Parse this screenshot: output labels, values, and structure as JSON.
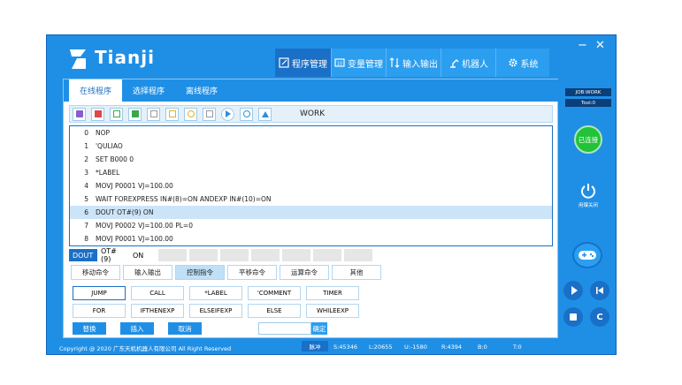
{
  "brand": {
    "name": "Tianji"
  },
  "window_controls": {
    "minimize": "−",
    "close": "✕"
  },
  "menu": [
    {
      "label": "程序管理",
      "icon": "edit-icon",
      "active": true
    },
    {
      "label": "变量管理",
      "icon": "variable-icon",
      "active": false
    },
    {
      "label": "输入输出",
      "icon": "io-icon",
      "active": false
    },
    {
      "label": "机器人",
      "icon": "robot-arm-icon",
      "active": false
    },
    {
      "label": "系统",
      "icon": "gear-icon",
      "active": false
    }
  ],
  "subtabs": [
    "在线程序",
    "选择程序",
    "离线程序"
  ],
  "toolbar": {
    "buttons": [
      {
        "icon": "code-icon",
        "color": "#8a5cd0"
      },
      {
        "icon": "delete-icon",
        "color": "#e04848"
      },
      {
        "icon": "copy-icon",
        "color": "#3aa84a"
      },
      {
        "icon": "image-icon",
        "color": "#3aa84a"
      },
      {
        "icon": "paste-icon",
        "color": "#9a9a9a"
      },
      {
        "icon": "copy-yellow-icon",
        "color": "#e8b020"
      },
      {
        "icon": "search-icon",
        "color": "#e8b020"
      },
      {
        "icon": "paste-gray-icon",
        "color": "#9a9a9a"
      },
      {
        "icon": "play-circle-icon",
        "color": "#2b8fe0"
      },
      {
        "icon": "recycle-icon",
        "color": "#2b8fe0"
      },
      {
        "icon": "upload-icon",
        "color": "#2b8fe0"
      }
    ],
    "job_name": "WORK"
  },
  "program_lines": [
    {
      "num": "0",
      "text": "NOP"
    },
    {
      "num": "1",
      "text": "'QULIAO"
    },
    {
      "num": "2",
      "text": "SET B000 0"
    },
    {
      "num": "3",
      "text": "*LABEL"
    },
    {
      "num": "4",
      "text": "MOVJ P0001 VJ=100.00"
    },
    {
      "num": "5",
      "text": "WAIT FOREXPRESS IN#(8)=ON ANDEXP IN#(10)=ON"
    },
    {
      "num": "6",
      "text": "DOUT OT#(9) ON"
    },
    {
      "num": "7",
      "text": "MOVJ P0002 VJ=100.00 PL=0"
    },
    {
      "num": "8",
      "text": "MOVJ P0001 VJ=100.00"
    }
  ],
  "selected_line": 6,
  "edit_row": {
    "cmd": "DOUT",
    "arg1": "OT#(9)",
    "arg2": "ON"
  },
  "command_tabs": [
    "移动命令",
    "输入输出",
    "控制指令",
    "平移命令",
    "运算命令",
    "其他"
  ],
  "active_command_tab": 2,
  "commands": [
    "JUMP",
    "CALL",
    "*LABEL",
    "'COMMENT",
    "TIMER",
    "FOR",
    "IFTHENEXP",
    "ELSEIFEXP",
    "ELSE",
    "WHILEEXP"
  ],
  "actions": {
    "replace": "替换",
    "insert": "插入",
    "cancel": "取消",
    "confirm": "确定"
  },
  "right_panel": {
    "job": "JOB:WORK",
    "tool": "Tool:0",
    "connection": "已连接",
    "power_label": "用爆关闭"
  },
  "footer": {
    "copyright": "Copyright @ 2020 广东天机机器人有限公司 All Right Reserved",
    "mode": "脉冲",
    "values": [
      "S:45346",
      "L:20655",
      "U:-1580",
      "R:4394",
      "B:0",
      "T:0"
    ]
  },
  "colors": {
    "primary": "#1f8fe6",
    "dark": "#1a6fc6",
    "connected": "#22c23a"
  }
}
